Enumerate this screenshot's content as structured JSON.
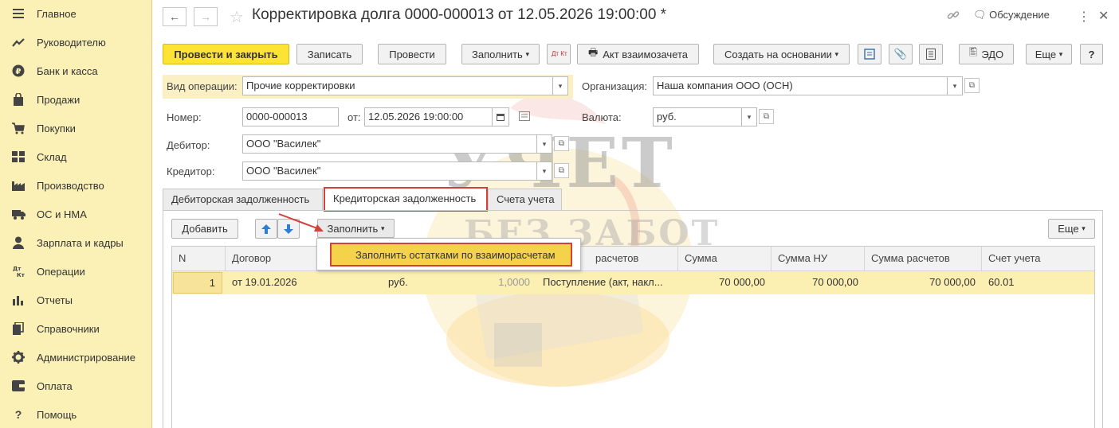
{
  "sidebar": {
    "items": [
      {
        "label": "Главное",
        "icon": "menu-icon"
      },
      {
        "label": "Руководителю",
        "icon": "trend-icon"
      },
      {
        "label": "Банк и касса",
        "icon": "ruble-icon"
      },
      {
        "label": "Продажи",
        "icon": "bag-icon"
      },
      {
        "label": "Покупки",
        "icon": "cart-icon"
      },
      {
        "label": "Склад",
        "icon": "warehouse-icon"
      },
      {
        "label": "Производство",
        "icon": "factory-icon"
      },
      {
        "label": "ОС и НМА",
        "icon": "truck-icon"
      },
      {
        "label": "Зарплата и кадры",
        "icon": "person-icon"
      },
      {
        "label": "Операции",
        "icon": "dt-kt-icon"
      },
      {
        "label": "Отчеты",
        "icon": "bar-chart-icon"
      },
      {
        "label": "Справочники",
        "icon": "books-icon"
      },
      {
        "label": "Администрирование",
        "icon": "gear-icon"
      },
      {
        "label": "Оплата",
        "icon": "wallet-icon"
      },
      {
        "label": "Помощь",
        "icon": "question-icon"
      }
    ]
  },
  "header": {
    "title": "Корректировка долга 0000-000013 от 12.05.2026 19:00:00 *",
    "discussion": "Обсуждение"
  },
  "toolbar": {
    "post_close": "Провести и закрыть",
    "save": "Записать",
    "post": "Провести",
    "fill": "Заполнить",
    "dt_kt": "Дт Кт",
    "offset_act": "Акт взаимозачета",
    "create_based": "Создать на основании",
    "edo": "ЭДО",
    "more": "Еще",
    "help": "?"
  },
  "form": {
    "op_type_label": "Вид операции:",
    "op_type_value": "Прочие корректировки",
    "org_label": "Организация:",
    "org_value": "Наша компания ООО (ОСН)",
    "number_label": "Номер:",
    "number_value": "0000-000013",
    "date_label": "от:",
    "date_value": "12.05.2026 19:00:00",
    "currency_label": "Валюта:",
    "currency_value": "руб.",
    "debtor_label": "Дебитор:",
    "debtor_value": "ООО \"Василек\"",
    "creditor_label": "Кредитор:",
    "creditor_value": "ООО \"Василек\""
  },
  "tabs": [
    {
      "label": "Дебиторская задолженность"
    },
    {
      "label": "Кредиторская задолженность"
    },
    {
      "label": "Счета учета"
    }
  ],
  "table_toolbar": {
    "add": "Добавить",
    "fill": "Заполнить",
    "more": "Еще",
    "fill_menu_item": "Заполнить остатками по взаиморасчетам"
  },
  "table": {
    "columns": [
      "N",
      "Договор",
      "",
      "",
      "расчетов",
      "Сумма",
      "Сумма НУ",
      "Сумма расчетов",
      "Счет учета"
    ],
    "rows": [
      {
        "n": "1",
        "contract": "от 19.01.2026",
        "currency": "руб.",
        "rate": "1,0000",
        "settlement": "Поступление (акт, накл...",
        "sum": "70 000,00",
        "sum_nu": "70 000,00",
        "sum_settle": "70 000,00",
        "account": "60.01"
      }
    ]
  },
  "watermark": {
    "line1": "УЧЕТ",
    "line2": "БЕЗ ЗАБОТ"
  }
}
